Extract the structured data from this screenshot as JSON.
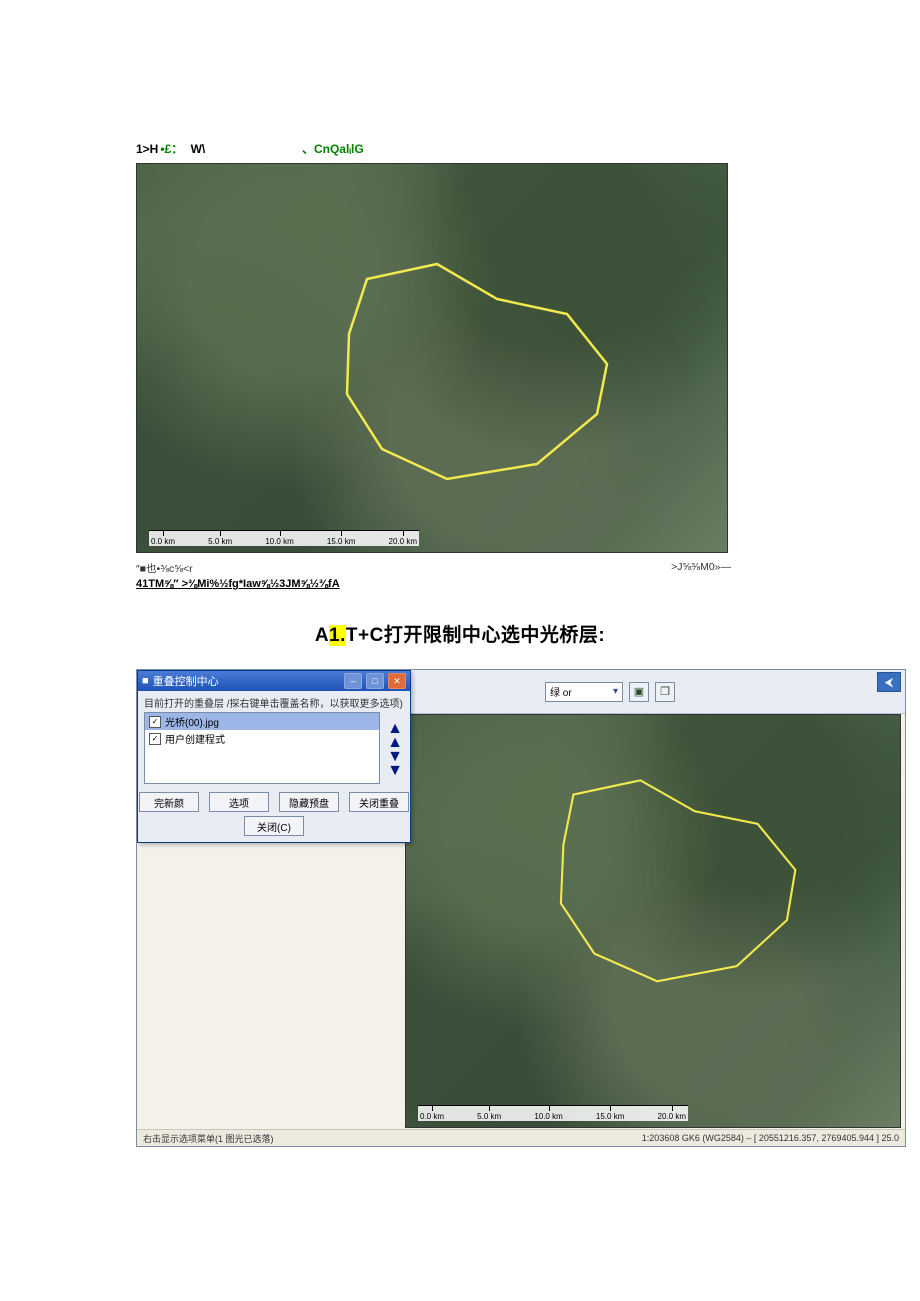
{
  "fig1": {
    "header": {
      "a": "1>H",
      "b": "•£：",
      "c": "W\\",
      "d": "、CnQalᵢlG"
    },
    "scale_ticks": [
      "0.0 km",
      "5.0 km",
      "10.0 km",
      "15.0 km",
      "20.0 km"
    ],
    "footer_left": "″■也•⅜c⅝<r",
    "footer_right": ">J⅝⅜M0»—",
    "footer2": "41TM⅝″ >⅜Mi%½fg*Iaw⅝½3JM⅝½⅜fA"
  },
  "heading": {
    "a": "A",
    "hl": "1.",
    "b": "T+C打开限制中心选中光桥层:"
  },
  "dialog": {
    "title_icon": "■",
    "title": "重叠控制中心",
    "sub": "目前打开的重叠层 /探右键单击覆盖名称，以获取更多选项)",
    "layers": [
      {
        "checked": true,
        "selected": true,
        "name": "光桥(00).jpg"
      },
      {
        "checked": true,
        "selected": false,
        "name": "用户创建程式"
      }
    ],
    "buttons": {
      "refresh": "完新颜",
      "options": "选项",
      "hide": "隐藏预盘",
      "close_layer": "关闭重叠",
      "close_dlg": "关闭(C)"
    }
  },
  "toolbar": {
    "combo_text": "绿  or"
  },
  "status": {
    "left": "右击显示选项菜单(1 图光已选落)",
    "right": "1:203608  GK6 (WG2584) – [ 20551216.357, 2769405.944 ]  25.0"
  },
  "scale_ticks2": [
    "0.0 km",
    "5.0 km",
    "10.0 km",
    "15.0 km",
    "20.0 km"
  ]
}
